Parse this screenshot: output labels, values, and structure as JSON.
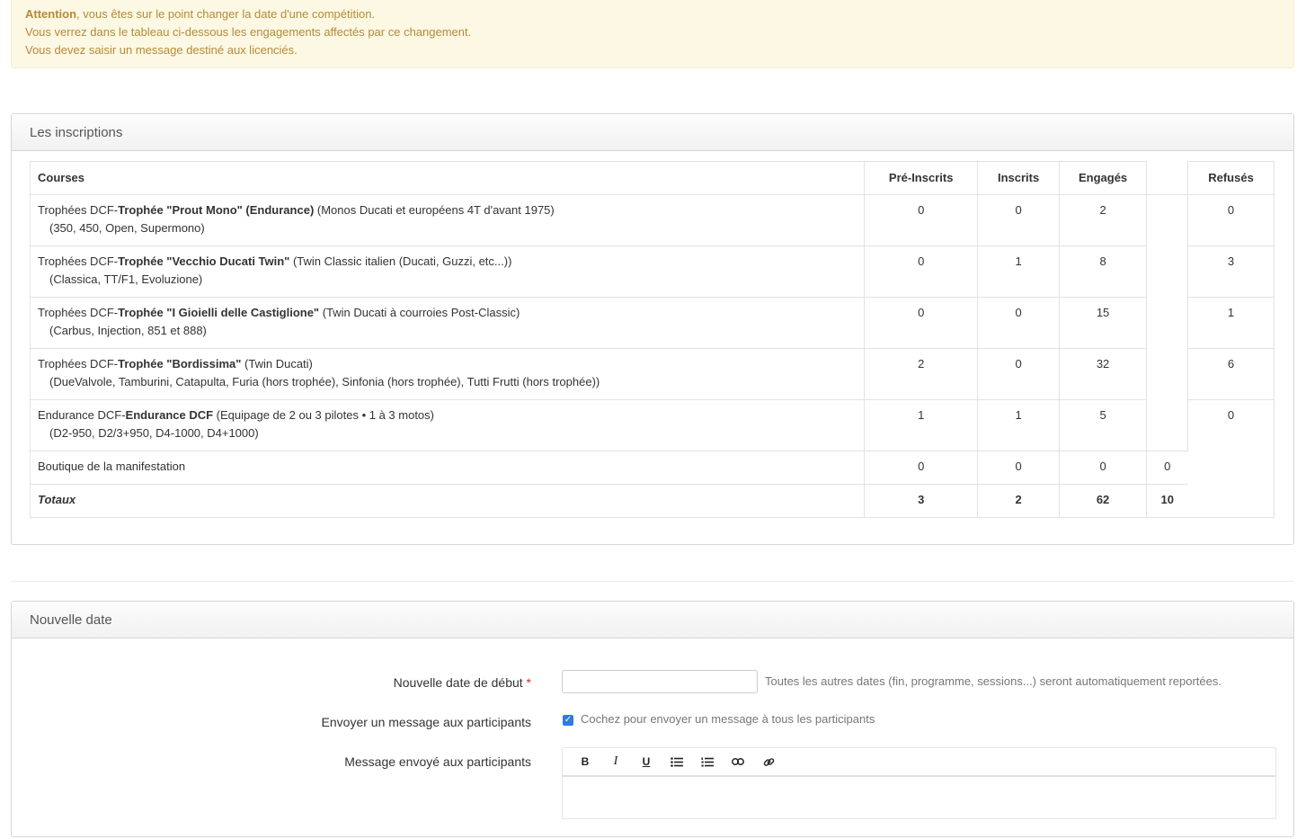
{
  "alert": {
    "strong": "Attention",
    "line1_rest": ", vous êtes sur le point changer la date d'une compétition.",
    "line2": "Vous verrez dans le tableau ci-dessous les engagements affectés par ce changement.",
    "line3": "Vous devez saisir un message destiné aux licenciés."
  },
  "inscriptions": {
    "title": "Les inscriptions",
    "headers": {
      "courses": "Courses",
      "pre": "Pré-Inscrits",
      "inscrits": "Inscrits",
      "engages": "Engagés",
      "refuses": "Refusés"
    },
    "rows": [
      {
        "prefix": "Trophées DCF-",
        "bold": "Trophée \"Prout Mono\" (Endurance)",
        "desc": " (Monos Ducati et européens 4T d'avant 1975)",
        "sub": "(350, 450, Open, Supermono)",
        "pre": "0",
        "inscrits": "0",
        "engages": "2",
        "refuses": "0"
      },
      {
        "prefix": "Trophées DCF-",
        "bold": "Trophée \"Vecchio Ducati Twin\"",
        "desc": " (Twin Classic italien (Ducati, Guzzi, etc...))",
        "sub": "(Classica, TT/F1, Evoluzione)",
        "pre": "0",
        "inscrits": "1",
        "engages": "8",
        "refuses": "3"
      },
      {
        "prefix": "Trophées DCF-",
        "bold": "Trophée \"I Gioielli delle Castiglione\"",
        "desc": " (Twin Ducati à courroies Post-Classic)",
        "sub": "(Carbus, Injection, 851 et 888)",
        "pre": "0",
        "inscrits": "0",
        "engages": "15",
        "refuses": "1"
      },
      {
        "prefix": "Trophées DCF-",
        "bold": "Trophée \"Bordissima\"",
        "desc": " (Twin Ducati)",
        "sub": "(DueValvole, Tamburini, Catapulta, Furia (hors trophée), Sinfonia (hors trophée), Tutti Frutti (hors trophée))",
        "pre": "2",
        "inscrits": "0",
        "engages": "32",
        "refuses": "6"
      },
      {
        "prefix": "Endurance DCF-",
        "bold": "Endurance DCF",
        "desc": " (Equipage de 2 ou 3 pilotes • 1 à 3 motos)",
        "sub": "(D2-950, D2/3+950, D4-1000, D4+1000)",
        "pre": "1",
        "inscrits": "1",
        "engages": "5",
        "refuses": "0"
      }
    ],
    "boutique": {
      "label": "Boutique de la manifestation",
      "pre": "0",
      "inscrits": "0",
      "engages": "0",
      "extra": "0"
    },
    "totaux": {
      "label": "Totaux",
      "pre": "3",
      "inscrits": "2",
      "engages": "62",
      "extra": "10"
    }
  },
  "nouvelle_date": {
    "title": "Nouvelle date",
    "date_label": "Nouvelle date de début",
    "required_mark": "*",
    "date_value": "",
    "date_help": "Toutes les autres dates (fin, programme, sessions...) seront automatiquement reportées.",
    "send_label": "Envoyer un message aux participants",
    "send_checked": true,
    "send_help": "Cochez pour envoyer un message à tous les participants",
    "message_label": "Message envoyé aux participants",
    "toolbar": {
      "bold": "B",
      "italic": "I",
      "underline": "U"
    }
  },
  "colors": {
    "accent": "#2f7ae5",
    "warning_text": "#b48a3a",
    "warning_bg": "#fcf8e3"
  }
}
